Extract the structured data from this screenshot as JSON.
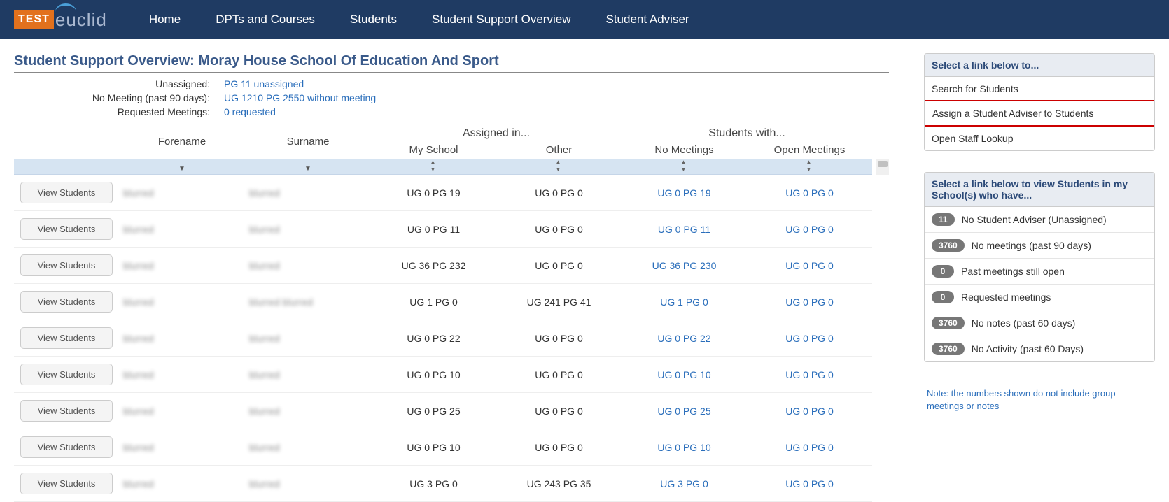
{
  "nav": {
    "logo_test": "TEST",
    "logo_brand": "euclid",
    "links": [
      "Home",
      "DPTs and Courses",
      "Students",
      "Student Support Overview",
      "Student Adviser"
    ]
  },
  "page": {
    "title": "Student Support Overview: Moray House School Of Education And Sport"
  },
  "summary": {
    "rows": [
      {
        "label": "Unassigned:",
        "value": "PG 11 unassigned"
      },
      {
        "label": "No Meeting (past 90 days):",
        "value": "UG 1210 PG 2550 without meeting"
      },
      {
        "label": "Requested Meetings:",
        "value": "0 requested"
      }
    ]
  },
  "table": {
    "headers": {
      "forename": "Forename",
      "surname": "Surname",
      "assigned_group": "Assigned in...",
      "students_group": "Students with...",
      "my_school": "My School",
      "other": "Other",
      "no_meetings": "No Meetings",
      "open_meetings": "Open Meetings"
    },
    "view_label": "View Students",
    "rows": [
      {
        "forename": "blurred",
        "surname": "blurred",
        "my_school": "UG 0 PG 19",
        "other": "UG 0 PG 0",
        "no_meetings": "UG 0 PG 19",
        "open_meetings": "UG 0 PG 0"
      },
      {
        "forename": "blurred",
        "surname": "blurred",
        "my_school": "UG 0 PG 11",
        "other": "UG 0 PG 0",
        "no_meetings": "UG 0 PG 11",
        "open_meetings": "UG 0 PG 0"
      },
      {
        "forename": "blurred",
        "surname": "blurred",
        "my_school": "UG 36 PG 232",
        "other": "UG 0 PG 0",
        "no_meetings": "UG 36 PG 230",
        "open_meetings": "UG 0 PG 0"
      },
      {
        "forename": "blurred",
        "surname": "blurred blurred",
        "my_school": "UG 1 PG 0",
        "other": "UG 241 PG 41",
        "no_meetings": "UG 1 PG 0",
        "open_meetings": "UG 0 PG 0"
      },
      {
        "forename": "blurred",
        "surname": "blurred",
        "my_school": "UG 0 PG 22",
        "other": "UG 0 PG 0",
        "no_meetings": "UG 0 PG 22",
        "open_meetings": "UG 0 PG 0"
      },
      {
        "forename": "blurred",
        "surname": "blurred",
        "my_school": "UG 0 PG 10",
        "other": "UG 0 PG 0",
        "no_meetings": "UG 0 PG 10",
        "open_meetings": "UG 0 PG 0"
      },
      {
        "forename": "blurred",
        "surname": "blurred",
        "my_school": "UG 0 PG 25",
        "other": "UG 0 PG 0",
        "no_meetings": "UG 0 PG 25",
        "open_meetings": "UG 0 PG 0"
      },
      {
        "forename": "blurred",
        "surname": "blurred",
        "my_school": "UG 0 PG 10",
        "other": "UG 0 PG 0",
        "no_meetings": "UG 0 PG 10",
        "open_meetings": "UG 0 PG 0"
      },
      {
        "forename": "blurred",
        "surname": "blurred",
        "my_school": "UG 3 PG 0",
        "other": "UG 243 PG 35",
        "no_meetings": "UG 3 PG 0",
        "open_meetings": "UG 0 PG 0"
      }
    ]
  },
  "sidebar": {
    "panel1": {
      "header": "Select a link below to...",
      "items": [
        {
          "label": "Search for Students"
        },
        {
          "label": "Assign a Student Adviser to Students",
          "highlight": true
        },
        {
          "label": "Open Staff Lookup"
        }
      ]
    },
    "panel2": {
      "header": "Select a link below to view Students in my School(s) who have...",
      "items": [
        {
          "badge": "11",
          "label": "No Student Adviser (Unassigned)"
        },
        {
          "badge": "3760",
          "label": "No meetings (past 90 days)"
        },
        {
          "badge": "0",
          "label": "Past meetings still open"
        },
        {
          "badge": "0",
          "label": "Requested meetings"
        },
        {
          "badge": "3760",
          "label": "No notes (past 60 days)"
        },
        {
          "badge": "3760",
          "label": "No Activity (past 60 Days)"
        }
      ],
      "note": "Note: the numbers shown do not include group meetings or notes"
    }
  }
}
